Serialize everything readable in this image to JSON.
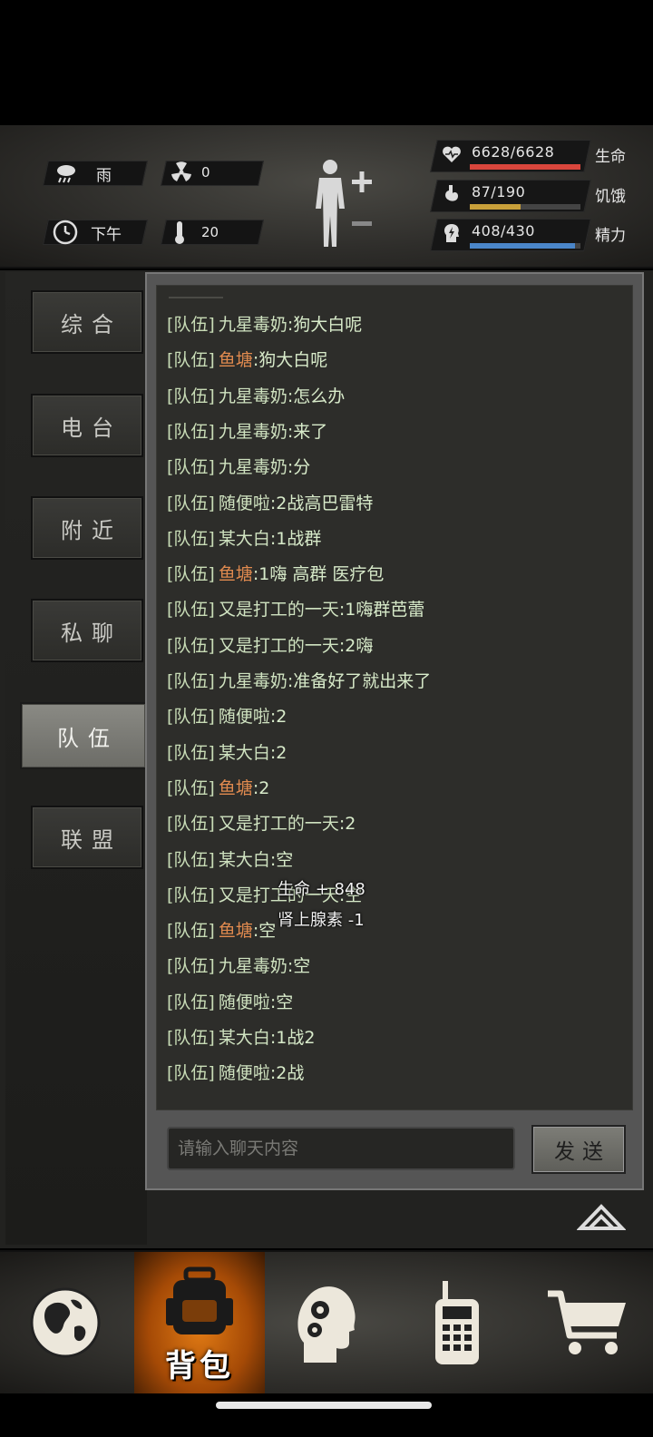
{
  "status": {
    "weather": "雨",
    "radiation": "0",
    "time_of_day": "下午",
    "temperature": "20",
    "health": {
      "label": "生命",
      "value": "6628/6628",
      "current": 6628,
      "max": 6628,
      "color": "#d9463c"
    },
    "hunger": {
      "label": "饥饿",
      "value": "87/190",
      "current": 87,
      "max": 190,
      "color": "#c9a03a"
    },
    "energy": {
      "label": "精力",
      "value": "408/430",
      "current": 408,
      "max": 430,
      "color": "#4a86c9"
    }
  },
  "tabs": [
    {
      "label": "综合",
      "active": false
    },
    {
      "label": "电台",
      "active": false
    },
    {
      "label": "附近",
      "active": false
    },
    {
      "label": "私聊",
      "active": false
    },
    {
      "label": "队伍",
      "active": true
    },
    {
      "label": "联盟",
      "active": false
    }
  ],
  "chat": {
    "messages": [
      {
        "channel": "[队伍]",
        "name": "九星毒奶",
        "orange": false,
        "text": ":狗大白呢"
      },
      {
        "channel": "[队伍]",
        "name": "鱼塘",
        "orange": true,
        "text": ":狗大白呢"
      },
      {
        "channel": "[队伍]",
        "name": "九星毒奶",
        "orange": false,
        "text": ":怎么办"
      },
      {
        "channel": "[队伍]",
        "name": "九星毒奶",
        "orange": false,
        "text": ":来了"
      },
      {
        "channel": "[队伍]",
        "name": "九星毒奶",
        "orange": false,
        "text": ":分"
      },
      {
        "channel": "[队伍]",
        "name": "随便啦",
        "orange": false,
        "text": ":2战高巴雷特"
      },
      {
        "channel": "[队伍]",
        "name": "某大白",
        "orange": false,
        "text": ":1战群"
      },
      {
        "channel": "[队伍]",
        "name": "鱼塘",
        "orange": true,
        "text": ":1嗨 高群 医疗包"
      },
      {
        "channel": "[队伍]",
        "name": "又是打工的一天",
        "orange": false,
        "text": ":1嗨群芭蕾"
      },
      {
        "channel": "[队伍]",
        "name": "又是打工的一天",
        "orange": false,
        "text": ":2嗨"
      },
      {
        "channel": "[队伍]",
        "name": "九星毒奶",
        "orange": false,
        "text": ":准备好了就出来了"
      },
      {
        "channel": "[队伍]",
        "name": "随便啦",
        "orange": false,
        "text": ":2"
      },
      {
        "channel": "[队伍]",
        "name": "某大白",
        "orange": false,
        "text": ":2"
      },
      {
        "channel": "[队伍]",
        "name": "鱼塘",
        "orange": true,
        "text": ":2"
      },
      {
        "channel": "[队伍]",
        "name": "又是打工的一天",
        "orange": false,
        "text": ":2"
      },
      {
        "channel": "[队伍]",
        "name": "某大白",
        "orange": false,
        "text": ":空"
      },
      {
        "channel": "[队伍]",
        "name": "又是打工的一天",
        "orange": false,
        "text": ":空"
      },
      {
        "channel": "[队伍]",
        "name": "鱼塘",
        "orange": true,
        "text": ":空"
      },
      {
        "channel": "[队伍]",
        "name": "九星毒奶",
        "orange": false,
        "text": ":空"
      },
      {
        "channel": "[队伍]",
        "name": "随便啦",
        "orange": false,
        "text": ":空"
      },
      {
        "channel": "[队伍]",
        "name": "某大白",
        "orange": false,
        "text": ":1战2"
      },
      {
        "channel": "[队伍]",
        "name": "随便啦",
        "orange": false,
        "text": ":2战"
      }
    ],
    "floating": [
      "生命 + 848",
      "肾上腺素 -1"
    ],
    "input_placeholder": "请输入聊天内容",
    "send_label": "发送"
  },
  "bottom_nav": {
    "items": [
      {
        "icon": "globe-icon",
        "active": false
      },
      {
        "icon": "backpack-icon",
        "active": true,
        "label": "背包"
      },
      {
        "icon": "head-gears-icon",
        "active": false
      },
      {
        "icon": "walkie-talkie-icon",
        "active": false
      },
      {
        "icon": "shopping-cart-icon",
        "active": false
      }
    ]
  }
}
